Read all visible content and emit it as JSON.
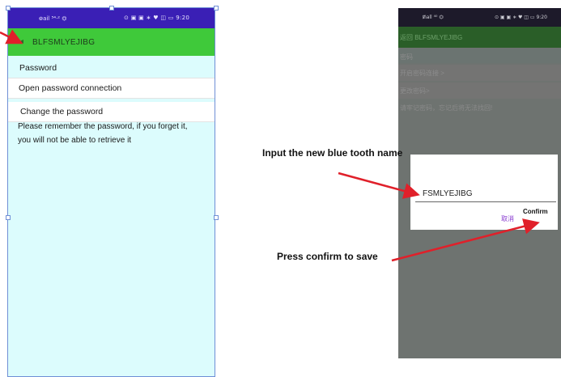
{
  "left_phone": {
    "status": {
      "signal": "᪤ail ⁵⁴·² ⏣",
      "icons": "⊙ ▣ ▣ ∗ ♥ ◫ ▭ 9:20"
    },
    "title": {
      "back": "◂",
      "device_name": "BLFSMLYEJIBG"
    },
    "rows": {
      "password": "Password",
      "open": "Open password connection",
      "change": "Change the password"
    },
    "notice_line1": "Please remember the password, if you forget it,",
    "notice_line2": "you will not be able to retrieve it"
  },
  "right_phone": {
    "status": {
      "signal": "ᵺall ⁴⁰ ⏣",
      "icons": "⊙ ▣ ▣ ∗ ♥ ◫ ▭ 9:20"
    },
    "title": "返回  BLFSMLYEJIBG",
    "rows": [
      "密码",
      "开启密码连接 >",
      "更改密码>"
    ],
    "notice": "请牢记密码，忘记后将无法找回!",
    "dialog": {
      "input_value": "FSMLYEJIBG",
      "cancel_label": "取消",
      "confirm_label": "Confirm"
    }
  },
  "annotations": {
    "input_note": "Input the new blue tooth name",
    "press_note": "Press confirm to save"
  },
  "colors": {
    "status_bar": "#3a1fb5",
    "title_bar": "#3fc93a",
    "background": "#dcfcfd",
    "arrow": "#e0202a"
  }
}
